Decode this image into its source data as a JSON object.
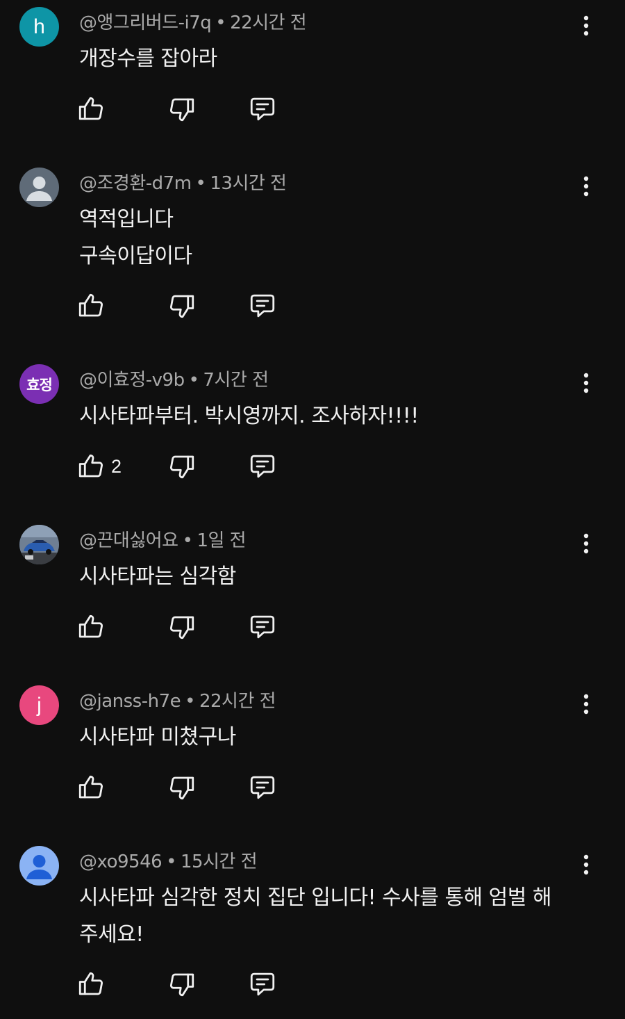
{
  "comments": [
    {
      "author": "@앵그리버드-i7q",
      "time": "22시간 전",
      "lines": [
        "개장수를 잡아라"
      ],
      "avatar": {
        "type": "letter",
        "text": "h",
        "color": "#0e95a6"
      },
      "likes": ""
    },
    {
      "author": "@조경환-d7m",
      "time": "13시간 전",
      "lines": [
        "역적입니다",
        "구속이답이다"
      ],
      "avatar": {
        "type": "default",
        "text": "",
        "color": "#5f6b78"
      },
      "likes": ""
    },
    {
      "author": "@이효정-v9b",
      "time": "7시간 전",
      "lines": [
        "시사타파부터. 박시영까지. 조사하자!!!!"
      ],
      "avatar": {
        "type": "hangul",
        "text": "효정",
        "color": "#7b2fb3"
      },
      "likes": "2"
    },
    {
      "author": "@끈대싫어요",
      "time": "1일 전",
      "lines": [
        "시사타파는 심각함"
      ],
      "avatar": {
        "type": "photo",
        "text": "",
        "color": "#2a5db0"
      },
      "likes": ""
    },
    {
      "author": "@janss-h7e",
      "time": "22시간 전",
      "lines": [
        "시사타파 미쳤구나"
      ],
      "avatar": {
        "type": "letter",
        "text": "j",
        "color": "#e8487e"
      },
      "likes": ""
    },
    {
      "author": "@xo9546",
      "time": "15시간 전",
      "lines": [
        "시사타파 심각한 정치 집단 입니다! 수사를 통해 엄벌 해",
        "주세요!"
      ],
      "avatar": {
        "type": "default-blue",
        "text": "",
        "color": "#8bb3f4"
      },
      "likes": ""
    }
  ],
  "separator": "•",
  "icons": {
    "like": "thumbs-up-icon",
    "dislike": "thumbs-down-icon",
    "reply": "reply-comment-icon",
    "menu": "more-vert-icon"
  }
}
